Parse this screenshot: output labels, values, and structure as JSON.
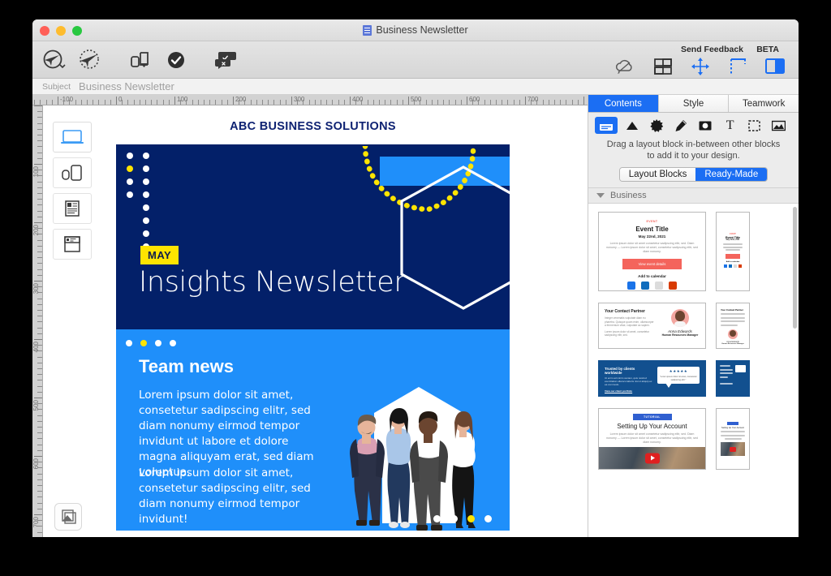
{
  "window": {
    "title": "Business Newsletter",
    "doc_icon": "document-icon",
    "traffic_lights": [
      "close",
      "minimize",
      "maximize"
    ]
  },
  "toolbar": {
    "left_tools": [
      {
        "name": "send-test-icon",
        "label": "Send Test"
      },
      {
        "name": "send-preview-icon",
        "label": "Preview"
      },
      {
        "name": "export-icon",
        "label": "Export"
      },
      {
        "name": "check-icon",
        "label": "Check"
      },
      {
        "name": "comments-icon",
        "label": "Comments"
      }
    ],
    "right_tools": [
      {
        "name": "cloud-sync-icon",
        "label": "Sync"
      },
      {
        "name": "layout-blocks-icon",
        "label": "Layout"
      },
      {
        "name": "spacing-icon",
        "label": "Spacing"
      },
      {
        "name": "margins-icon",
        "label": "Margins"
      },
      {
        "name": "inspector-panel-icon",
        "label": "Inspector"
      }
    ],
    "send_feedback_label": "Send Feedback",
    "beta_label": "BETA"
  },
  "subject": {
    "label": "Subject",
    "value": "Business Newsletter",
    "placeholder": "Business Newsletter"
  },
  "rulers": {
    "horizontal_ticks": [
      -100,
      0,
      100,
      200,
      300,
      400,
      500,
      600,
      700
    ],
    "vertical_ticks": [
      0,
      100,
      200,
      300,
      400,
      500,
      600,
      700
    ]
  },
  "device_rail": {
    "items": [
      {
        "name": "device-desktop",
        "icon": "laptop-icon",
        "active": true
      },
      {
        "name": "device-mobile",
        "icon": "phone-watch-icon",
        "active": false
      },
      {
        "name": "device-plaintext",
        "icon": "text-document-icon",
        "active": false
      },
      {
        "name": "device-inbox-preview",
        "icon": "mail-preview-icon",
        "active": false
      }
    ],
    "layers_button": {
      "name": "layers-button",
      "icon": "layers-icon"
    }
  },
  "newsletter": {
    "brand_title": "ABC BUSINESS SOLUTIONS",
    "hero": {
      "badge": "MAY",
      "heading": "Insights Newsletter",
      "bg_color": "#032069",
      "accent_color": "#ffe400",
      "blue_bar_color": "#1f8ffa"
    },
    "team_news": {
      "title": "Team news",
      "paragraph_1": "Lorem ipsum dolor sit amet, consetetur sadipscing elitr, sed diam nonumy eirmod tempor invidunt ut labore et dolore magna aliquyam erat, sed diam voluptua.",
      "paragraph_2": "Lorem ipsum dolor sit amet, consetetur sadipscing elitr, sed diam nonumy eirmod tempor invidunt!",
      "bg_color": "#1f8ffa",
      "dots": [
        "white",
        "yellow",
        "white",
        "white"
      ],
      "bottom_dots": [
        "white",
        "white",
        "yellow",
        "white"
      ]
    }
  },
  "right_panel": {
    "tabs": [
      {
        "label": "Contents",
        "active": true
      },
      {
        "label": "Style",
        "active": false
      },
      {
        "label": "Teamwork",
        "active": false
      }
    ],
    "block_icons": [
      {
        "name": "layout-block-icon",
        "active": true
      },
      {
        "name": "shape-triangle-icon",
        "active": false
      },
      {
        "name": "star-burst-icon",
        "active": false
      },
      {
        "name": "pen-icon",
        "active": false
      },
      {
        "name": "camera-icon",
        "active": false
      },
      {
        "name": "text-icon",
        "active": false
      },
      {
        "name": "placeholder-box-icon",
        "active": false
      },
      {
        "name": "image-icon",
        "active": false
      }
    ],
    "hint": "Drag a layout block in-between other blocks to add it to your design.",
    "segmented": [
      {
        "label": "Layout Blocks",
        "active": false
      },
      {
        "label": "Ready-Made",
        "active": true
      }
    ],
    "group": {
      "label": "Business",
      "expanded": true
    },
    "templates": [
      {
        "name": "event-template",
        "eyebrow": "EVENT",
        "title": "Event Title",
        "date": "May 22nd, 2021",
        "body": "Lorem ipsum dolor sit amet consetetur sadipscing elitr, sed. Diam nonumy — Lorem ipsum dolor sit amet, consetetur sadipscing elitr, sed diam nonumy.",
        "button": "View event details",
        "footer": "Add to calendar",
        "icons": [
          "google-calendar-icon",
          "outlook-icon",
          "apple-calendar-icon",
          "office-icon"
        ]
      },
      {
        "name": "contact-partner-template",
        "title": "Your Contact Partner",
        "body": "Integer venenatis vulputate diam eu pharetra. Quisque quam enim, ullamcorper a fermentum vitae, vulputate ac sapien.",
        "body2": "Lorem ipsum dolor sit amet, consetetur sadipscing elitr, sed.",
        "signature": "Anna Edwards",
        "role": "Human Resources Manager"
      },
      {
        "name": "testimonial-template",
        "title": "Trusted by clients worldwide",
        "body": "Ut enim ad minim veniam, quis nostrud exercitation ullamco laboris nisi ut aliquip ex ea commodo.",
        "link": "View our client portfolio",
        "quote": "\"Lorem ipsum dolor sit amet, consetetur sadipscing elitr.\"",
        "stars": 5
      },
      {
        "name": "tutorial-video-template",
        "eyebrow": "TUTORIAL",
        "title": "Setting Up Your Account",
        "body": "Lorem ipsum dolor sit amet consetetur sadipscing elitr, sed. Diam nonumy — Lorem ipsum dolor sit amet, consetetur sadipscing elitr, sed diam nonumy.",
        "has_video": true
      }
    ]
  }
}
